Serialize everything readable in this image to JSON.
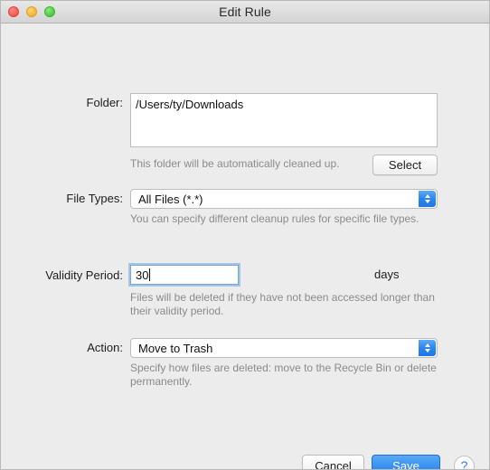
{
  "window": {
    "title": "Edit Rule",
    "traffic_lights": [
      {
        "name": "close",
        "color": "#f9564c"
      },
      {
        "name": "minimize",
        "color": "#f7b32c"
      },
      {
        "name": "zoom",
        "color": "#4bcc3f"
      }
    ]
  },
  "form": {
    "folder": {
      "label": "Folder:",
      "value": "/Users/ty/Downloads",
      "hint": "This folder will be automatically cleaned up.",
      "select_button": "Select"
    },
    "file_types": {
      "label": "File Types:",
      "value": "All Files (*.*)",
      "hint": "You can specify different cleanup rules for specific file types."
    },
    "validity_period": {
      "label": "Validity Period:",
      "value": "30",
      "unit": "days",
      "hint": "Files will be deleted if they have not been accessed longer than their validity period."
    },
    "action": {
      "label": "Action:",
      "value": "Move to Trash",
      "hint": "Specify how files are deleted: move to the Recycle Bin or delete permanently."
    }
  },
  "footer": {
    "cancel": "Cancel",
    "save": "Save",
    "help": "?"
  },
  "colors": {
    "accent": "#2b86ee",
    "window_bg": "#ececec",
    "hint_text": "#8b8b8b"
  }
}
